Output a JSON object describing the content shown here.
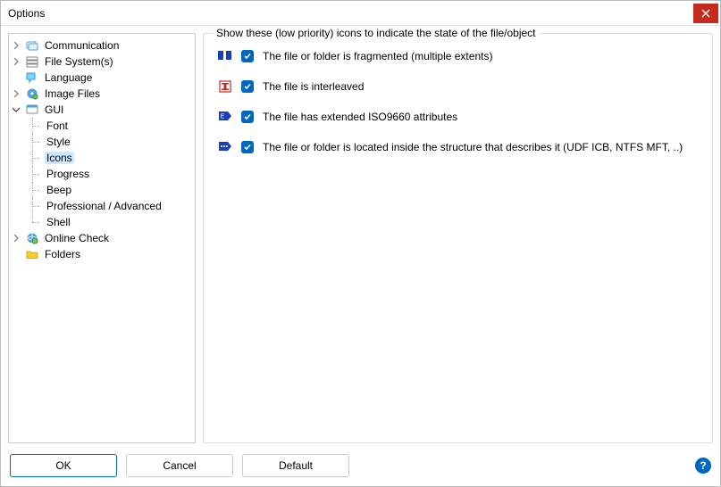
{
  "window": {
    "title": "Options"
  },
  "tree": {
    "communication": "Communication",
    "filesystems": "File System(s)",
    "language": "Language",
    "imagefiles": "Image Files",
    "gui": "GUI",
    "gui_children": {
      "font": "Font",
      "style": "Style",
      "icons": "Icons",
      "progress": "Progress",
      "beep": "Beep",
      "professional": "Professional / Advanced",
      "shell": "Shell"
    },
    "onlinecheck": "Online Check",
    "folders": "Folders"
  },
  "panel": {
    "legend": "Show these (low priority) icons to indicate the state of the file/object",
    "opt_fragmented": "The file or folder is fragmented (multiple extents)",
    "opt_interleaved": "The file is interleaved",
    "opt_iso9660": "The file has extended ISO9660 attributes",
    "opt_udf": "The file or folder is located inside the structure that describes it (UDF ICB, NTFS MFT, ..)"
  },
  "buttons": {
    "ok": "OK",
    "cancel": "Cancel",
    "default": "Default"
  },
  "options_state": {
    "fragmented": true,
    "interleaved": true,
    "iso9660": true,
    "udf": true
  }
}
